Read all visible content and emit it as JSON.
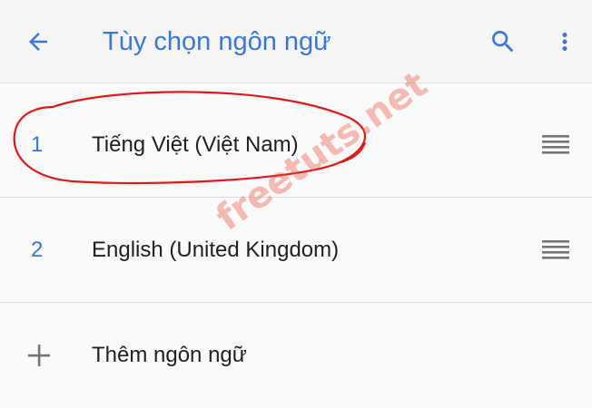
{
  "app_bar": {
    "title": "Tùy chọn ngôn ngữ",
    "back_icon": "arrow-back-icon",
    "search_icon": "search-icon",
    "more_icon": "more-vert-icon"
  },
  "languages": [
    {
      "index": "1",
      "label": "Tiếng Việt (Việt Nam)",
      "handle_icon": "drag-handle-icon"
    },
    {
      "index": "2",
      "label": "English (United Kingdom)",
      "handle_icon": "drag-handle-icon"
    }
  ],
  "add_language": {
    "icon": "plus-icon",
    "label": "Thêm ngôn ngữ"
  },
  "watermark": "freetuts.net",
  "colors": {
    "accent": "#3b78d8",
    "icon_grey": "#757575",
    "annotation_red": "#e01818",
    "watermark": "#e8503c"
  }
}
